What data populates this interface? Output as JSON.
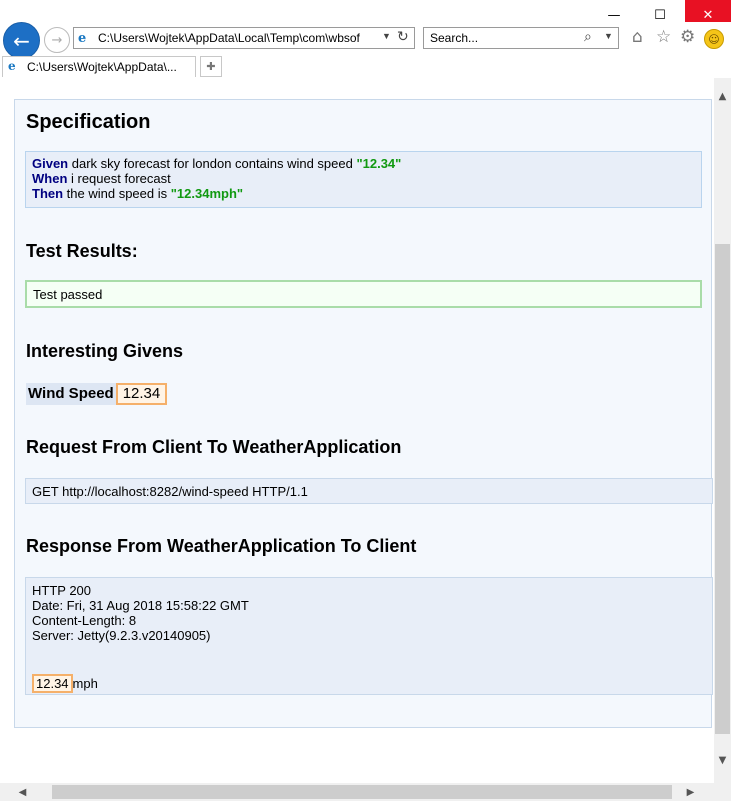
{
  "window": {
    "minimize_glyph": "—",
    "maximize_glyph": "☐",
    "close_glyph": "✕"
  },
  "toolbar": {
    "back_glyph": "←",
    "forward_glyph": "→",
    "address_value": "C:\\Users\\Wojtek\\AppData\\Local\\Temp\\com\\wbsoftw",
    "address_dropdown_glyph": "▼",
    "refresh_glyph": "↻",
    "search_placeholder": "Search...",
    "search_icon_glyph": "⌕",
    "search_dropdown_glyph": "▼",
    "home_glyph": "⌂",
    "favorites_glyph": "☆",
    "settings_glyph": "⚙",
    "feedback_glyph": "☺",
    "icons": [
      "back-icon",
      "forward-icon",
      "ie-icon",
      "dropdown-icon",
      "refresh-icon",
      "search-icon",
      "home-icon",
      "favorites-icon",
      "settings-icon",
      "smiley-icon"
    ]
  },
  "tabs": [
    {
      "label": "C:\\Users\\Wojtek\\AppData\\...",
      "favicon": "e"
    }
  ],
  "new_tab_glyph": "✚",
  "page": {
    "spec_heading": "Specification",
    "spec": {
      "given_kw": "Given",
      "given_text": " dark sky forecast for london contains wind speed ",
      "given_value": "\"12.34\"",
      "when_kw": "When",
      "when_text": " i request forecast",
      "then_kw": "Then",
      "then_text": " the wind speed is ",
      "then_value": "\"12.34mph\""
    },
    "results_heading": "Test Results:",
    "result_text": "Test passed",
    "givens_heading": "Interesting Givens",
    "givens": [
      {
        "name": "Wind Speed",
        "value": "12.34"
      }
    ],
    "request_heading": "Request From Client To WeatherApplication",
    "request_line": "GET http://localhost:8282/wind-speed HTTP/1.1",
    "response_heading": "Response From WeatherApplication To Client",
    "response_lines": [
      "HTTP 200",
      "Date: Fri, 31 Aug 2018 15:58:22 GMT",
      "Content-Length: 8",
      "Server: Jetty(9.2.3.v20140905)"
    ],
    "response_body_value": "12.34",
    "response_body_suffix": "mph"
  },
  "scroll": {
    "up_glyph": "▲",
    "down_glyph": "▼",
    "left_glyph": "◀",
    "right_glyph": "▶"
  },
  "colors": {
    "keyword": "#000080",
    "string_value": "#119911",
    "passed_border": "#a9dca9",
    "highlight_border": "#f5b06a",
    "close_button": "#e81123",
    "back_button": "#1d6fc5"
  }
}
